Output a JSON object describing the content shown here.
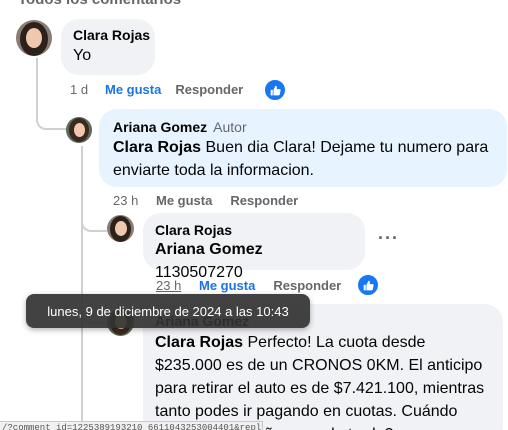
{
  "header": {
    "partial_text": "Todos los comentarios"
  },
  "comments": [
    {
      "author": "Clara Rojas",
      "text": "Yo",
      "time": "1 d",
      "like_label": "Me gusta",
      "reply_label": "Responder",
      "reaction": "like-icon"
    },
    {
      "author": "Ariana Gomez",
      "badge": "Autor",
      "mention": "Clara Rojas",
      "text": " Buen dia Clara! Dejame tu numero para enviarte toda la informacion.",
      "time": "23 h",
      "like_label": "Me gusta",
      "reply_label": "Responder"
    },
    {
      "author": "Clara Rojas",
      "mention": "Ariana Gomez",
      "text": " 1130507270",
      "time": "23 h",
      "like_label": "Me gusta",
      "reply_label": "Responder",
      "more_label": "···",
      "reaction": "like-icon"
    },
    {
      "author": "Ariana Gomez",
      "mention": "Clara Rojas",
      "text": " Perfecto! La cuota desde $235.000 es de un CRONOS 0KM. El anticipo para retirar el auto es de $7.421.100, mientras tanto podes ir pagando en cuotas. Cuándo podes venir mañana o a la tarde?"
    }
  ],
  "tooltip": {
    "text": "lunes, 9 de diciembre de 2024 a las 10:43"
  },
  "statusbar": {
    "url": "/?comment_id=1225389193210_6611043253004401&reply_comment_id=..."
  },
  "colors": {
    "accent": "#1877f2",
    "author_bubble": "#e7f3ff",
    "bubble": "#f0f2f5"
  }
}
